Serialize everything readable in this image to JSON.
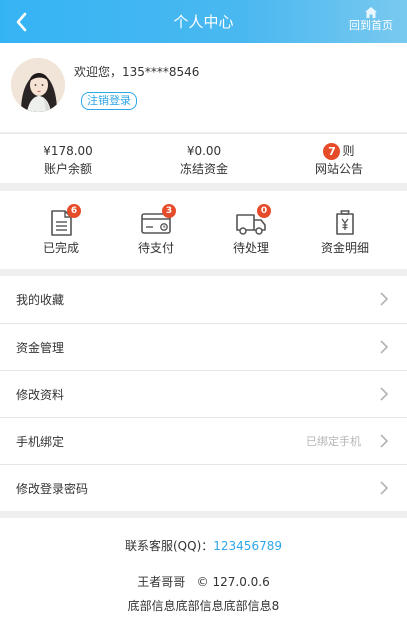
{
  "header": {
    "title": "个人中心",
    "home_label": "回到首页"
  },
  "profile": {
    "welcome": "欢迎您，135****8546",
    "logout_label": "注销登录"
  },
  "stats": [
    {
      "value": "¥178.00",
      "label": "账户余额"
    },
    {
      "value": "¥0.00",
      "label": "冻结资金"
    },
    {
      "count": "7",
      "unit": "则",
      "label": "网站公告"
    }
  ],
  "orders": [
    {
      "label": "已完成",
      "icon": "document-icon",
      "badge": "6"
    },
    {
      "label": "待支付",
      "icon": "credit-card-icon",
      "badge": "3"
    },
    {
      "label": "待处理",
      "icon": "truck-icon",
      "badge": "0"
    },
    {
      "label": "资金明细",
      "icon": "money-bag-icon",
      "badge": ""
    }
  ],
  "menu": [
    {
      "label": "我的收藏",
      "value": ""
    },
    {
      "label": "资金管理",
      "value": ""
    },
    {
      "label": "修改资料",
      "value": ""
    },
    {
      "label": "手机绑定",
      "value": "已绑定手机"
    },
    {
      "label": "修改登录密码",
      "value": ""
    }
  ],
  "footer": {
    "contact_label": "联系客服(QQ)：",
    "contact_qq": "123456789",
    "copyright": "王者哥哥   © 127.0.0.6",
    "info": "底部信息底部信息底部信息8"
  },
  "colors": {
    "header_start": "#35b4f4",
    "header_end": "#79c9ef",
    "accent": "#2fa6e7",
    "badge": "#e74c2a"
  }
}
